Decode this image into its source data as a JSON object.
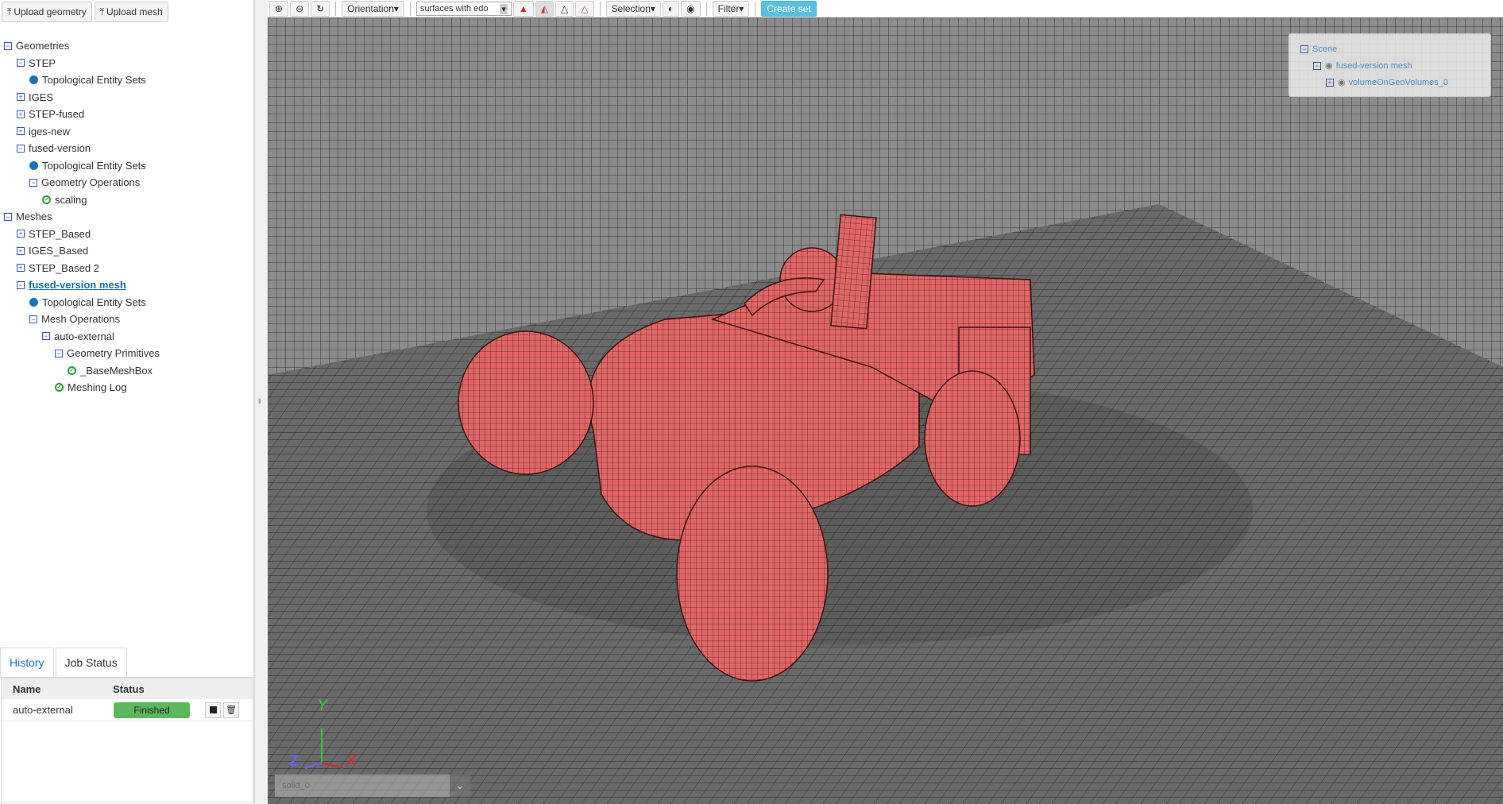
{
  "left": {
    "upload_geometry": "Upload geometry",
    "upload_mesh": "Upload mesh",
    "tree": [
      {
        "label": "Geometries",
        "level": 0,
        "type": "minus"
      },
      {
        "label": "STEP",
        "level": 1,
        "type": "minus"
      },
      {
        "label": "Topological Entity Sets",
        "level": 2,
        "type": "dot"
      },
      {
        "label": "IGES",
        "level": 1,
        "type": "plus"
      },
      {
        "label": "STEP-fused",
        "level": 1,
        "type": "plus"
      },
      {
        "label": "iges-new",
        "level": 1,
        "type": "plus"
      },
      {
        "label": "fused-version",
        "level": 1,
        "type": "minus"
      },
      {
        "label": "Topological Entity Sets",
        "level": 2,
        "type": "dot"
      },
      {
        "label": "Geometry Operations",
        "level": 2,
        "type": "minus"
      },
      {
        "label": "scaling",
        "level": 3,
        "type": "ok"
      },
      {
        "label": "Meshes",
        "level": 0,
        "type": "minus"
      },
      {
        "label": "STEP_Based",
        "level": 1,
        "type": "plus"
      },
      {
        "label": "IGES_Based",
        "level": 1,
        "type": "plus"
      },
      {
        "label": "STEP_Based 2",
        "level": 1,
        "type": "plus"
      },
      {
        "label": "fused-version mesh",
        "level": 1,
        "type": "minus",
        "selected": true
      },
      {
        "label": "Topological Entity Sets",
        "level": 2,
        "type": "dot"
      },
      {
        "label": "Mesh Operations",
        "level": 2,
        "type": "minus"
      },
      {
        "label": "auto-external",
        "level": 3,
        "type": "minus"
      },
      {
        "label": "Geometry Primitives",
        "level": 4,
        "type": "minus"
      },
      {
        "label": "_BaseMeshBox",
        "level": 5,
        "type": "ok"
      },
      {
        "label": "Meshing Log",
        "level": 4,
        "type": "ok"
      }
    ],
    "tabs": {
      "history": "History",
      "job_status": "Job Status"
    },
    "jobs": {
      "col_name": "Name",
      "col_status": "Status",
      "rows": [
        {
          "name": "auto-external",
          "status": "Finished"
        }
      ]
    }
  },
  "toolbar": {
    "orientation": "Orientation",
    "render_mode": "surfaces with edo",
    "selection": "Selection",
    "filter": "Filter",
    "create_set": "Create set"
  },
  "scene": {
    "root": "Scene",
    "mesh": "fused-version mesh",
    "volume": "volumeOnGeoVolumes_0"
  },
  "viewport": {
    "solid_select": "solid_0",
    "axes": {
      "x": "X",
      "y": "Y",
      "z": "Z"
    },
    "mesh_color": "#e06666"
  }
}
